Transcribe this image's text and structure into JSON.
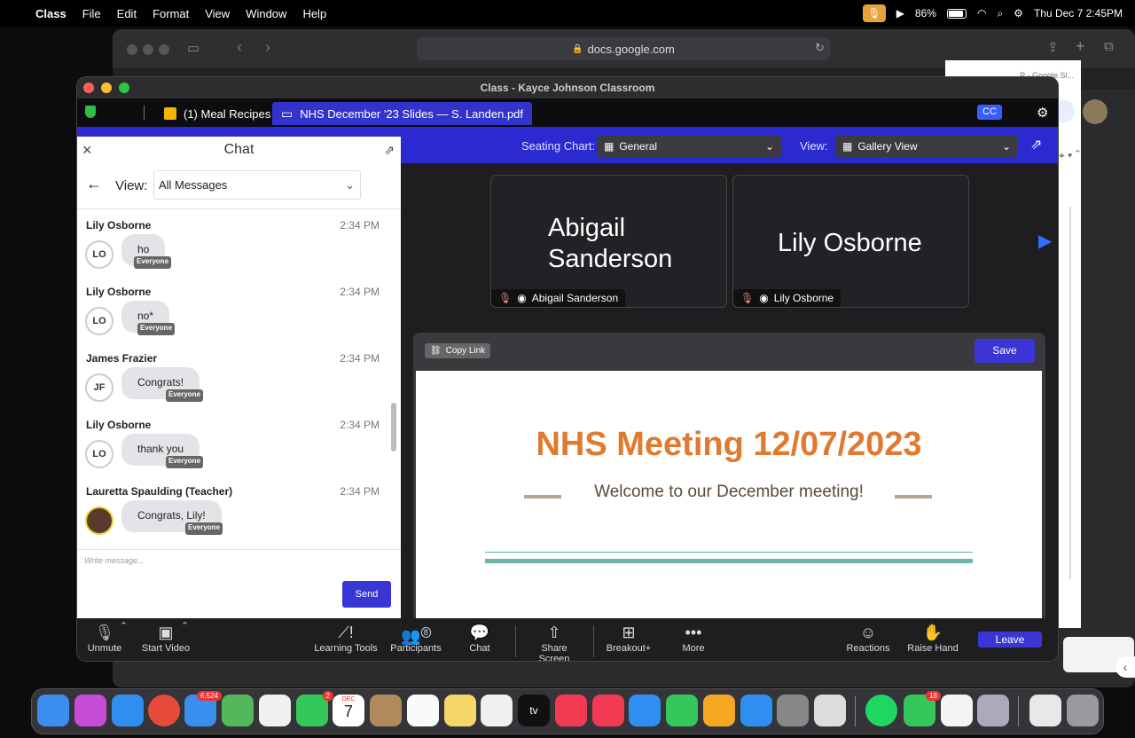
{
  "menubar": {
    "app": "Class",
    "items": [
      "File",
      "Edit",
      "Format",
      "View",
      "Window",
      "Help"
    ],
    "battery": "86%",
    "datetime": "Thu Dec 7  2:45PM"
  },
  "safari": {
    "url": "docs.google.com",
    "tab_right": "P - Google Sl..."
  },
  "window": {
    "title": "Class - Kayce Johnson Classroom",
    "tabs": [
      {
        "label": "(1) Meal Recipes"
      },
      {
        "label": "NHS December '23 Slides — S. Landen.pdf"
      }
    ],
    "cc": "CC"
  },
  "bluebar": {
    "seating_label": "Seating Chart:",
    "seating_value": "General",
    "view_label": "View:",
    "view_value": "Gallery View"
  },
  "chat": {
    "title": "Chat",
    "view_label": "View:",
    "view_value": "All Messages",
    "placeholder": "Write message...",
    "send": "Send",
    "messages": [
      {
        "name": "Lily Osborne",
        "time": "2:34 PM",
        "initials": "LO",
        "text": "ho",
        "audience": "Everyone"
      },
      {
        "name": "Lily Osborne",
        "time": "2:34 PM",
        "initials": "LO",
        "text": "no*",
        "audience": "Everyone"
      },
      {
        "name": "James Frazier",
        "time": "2:34 PM",
        "initials": "JF",
        "text": "Congrats!",
        "audience": "Everyone"
      },
      {
        "name": "Lily Osborne",
        "time": "2:34 PM",
        "initials": "LO",
        "text": "thank you",
        "audience": "Everyone"
      },
      {
        "name": "Lauretta Spaulding (Teacher)",
        "time": "2:34 PM",
        "initials": "",
        "text": "Congrats, Lily!",
        "audience": "Everyone"
      }
    ]
  },
  "tiles": [
    {
      "big1": "Abigail",
      "big2": "Sanderson",
      "caption": "Abigail Sanderson"
    },
    {
      "big1": "Lily Osborne",
      "big2": "",
      "caption": "Lily Osborne"
    }
  ],
  "share": {
    "copy_link": "Copy Link",
    "save": "Save",
    "slide_title": "NHS Meeting 12/07/2023",
    "slide_subtitle": "Welcome to our December meeting!"
  },
  "toolbar": {
    "unmute": "Unmute",
    "start_video": "Start Video",
    "learning_tools": "Learning Tools",
    "participants": "Participants",
    "participants_count": "8",
    "chat": "Chat",
    "share_screen": "Share Screen",
    "breakout": "Breakout+",
    "more": "More",
    "reactions": "Reactions",
    "raise_hand": "Raise Hand",
    "leave": "Leave"
  },
  "dock": {
    "mail_badge": "6,524",
    "facetime_badge": "2",
    "calendar_month": "DEC",
    "calendar_day": "7",
    "appletv_label": "tv",
    "messages_badge": "18"
  }
}
